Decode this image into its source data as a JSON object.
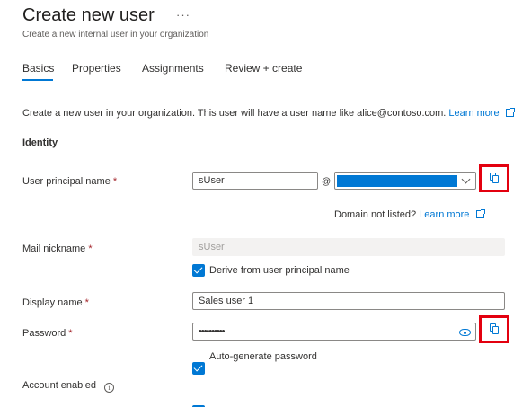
{
  "header": {
    "title": "Create new user",
    "more_label": "···",
    "subtitle": "Create a new internal user in your organization"
  },
  "tabs": [
    {
      "label": "Basics",
      "selected": true
    },
    {
      "label": "Properties",
      "selected": false
    },
    {
      "label": "Assignments",
      "selected": false
    },
    {
      "label": "Review + create",
      "selected": false
    }
  ],
  "intro": {
    "text": "Create a new user in your organization. This user will have a user name like alice@contoso.com.",
    "link_label": "Learn more"
  },
  "identity": {
    "heading": "Identity",
    "upn": {
      "label": "User principal name",
      "required_mark": "*",
      "value": "sUser",
      "at_symbol": "@",
      "domain_value": ""
    },
    "domain_help": {
      "text": "Domain not listed?",
      "link_label": "Learn more"
    },
    "mail_nickname": {
      "label": "Mail nickname",
      "required_mark": "*",
      "value": "sUser",
      "derive_label": "Derive from user principal name",
      "derive_checked": true
    },
    "display_name": {
      "label": "Display name",
      "required_mark": "*",
      "value": "Sales user 1"
    },
    "password": {
      "label": "Password",
      "required_mark": "*",
      "value": "••••••••••",
      "autogen_label": "Auto-generate password",
      "autogen_checked": true
    },
    "account_enabled": {
      "label": "Account enabled",
      "info_glyph": "i",
      "checked": true
    }
  },
  "icons": {
    "copy": "copy-icon",
    "external": "external-link-icon",
    "eye": "eye-icon",
    "info": "info-icon",
    "chevron": "chevron-down-icon"
  },
  "colors": {
    "accent": "#0078d4",
    "highlight_box": "#e3000f",
    "required": "#a4262c"
  }
}
